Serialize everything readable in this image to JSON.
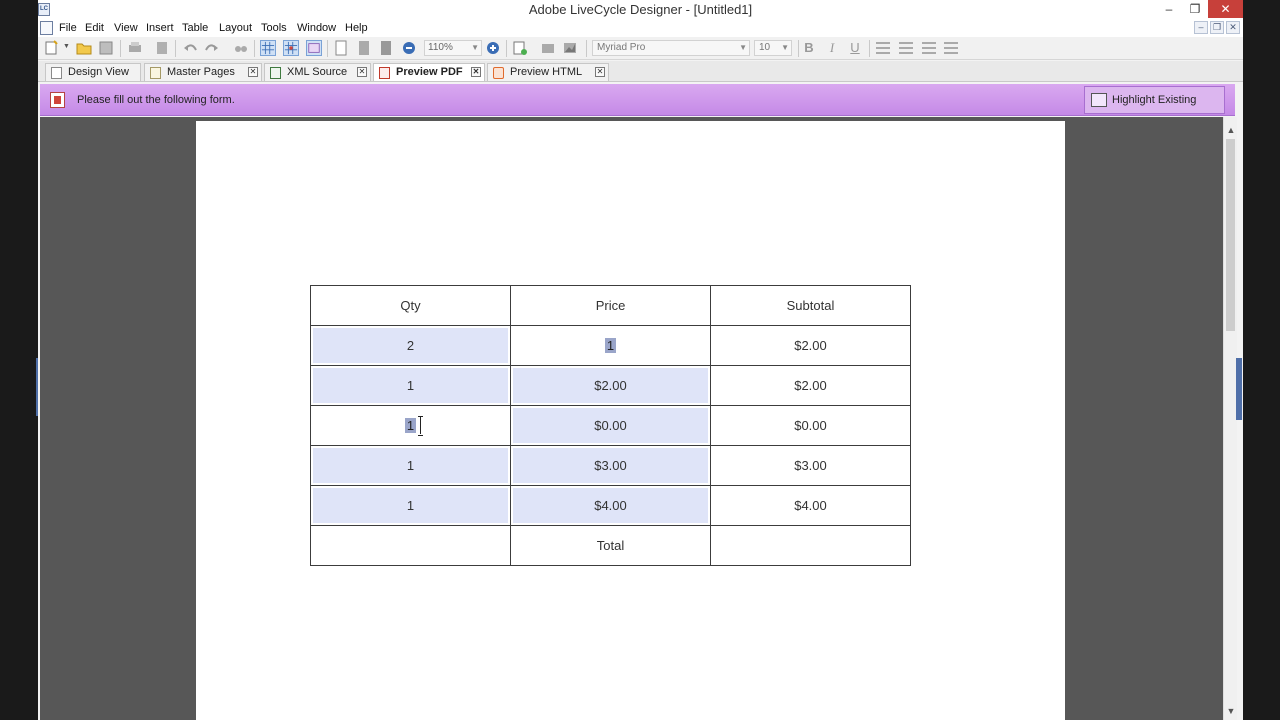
{
  "window": {
    "title": "Adobe LiveCycle Designer - [Untitled1]",
    "app_icon_label": "LC",
    "minimize": "–",
    "maximize": "❐",
    "close": "✕"
  },
  "menu": {
    "items": [
      "File",
      "Edit",
      "View",
      "Insert",
      "Table",
      "Layout",
      "Tools",
      "Window",
      "Help"
    ],
    "mdi": [
      "–",
      "❐",
      "✕"
    ]
  },
  "toolbar": {
    "zoom": "110%",
    "font": "Myriad Pro",
    "size": "10",
    "bold": "B",
    "italic": "I",
    "underline": "U"
  },
  "tabs": [
    {
      "label": "Design View",
      "icon": "document-icon",
      "active": false
    },
    {
      "label": "Master Pages",
      "icon": "master-pages-icon",
      "active": false
    },
    {
      "label": "XML Source",
      "icon": "xml-icon",
      "active": false
    },
    {
      "label": "Preview PDF",
      "icon": "pdf-icon",
      "active": true
    },
    {
      "label": "Preview HTML",
      "icon": "html5-icon",
      "active": false
    }
  ],
  "notice": {
    "text": "Please fill out the following form.",
    "button": "Highlight Existing Fields"
  },
  "form": {
    "headers": [
      "Qty",
      "Price",
      "Subtotal"
    ],
    "rows": [
      {
        "qty": "2",
        "price": "1",
        "subtotal": "$2.00"
      },
      {
        "qty": "1",
        "price": "$2.00",
        "subtotal": "$2.00"
      },
      {
        "qty": "1",
        "price": "$0.00",
        "subtotal": "$0.00"
      },
      {
        "qty": "1",
        "price": "$3.00",
        "subtotal": "$3.00"
      },
      {
        "qty": "1",
        "price": "$4.00",
        "subtotal": "$4.00"
      }
    ],
    "footer": {
      "label": "Total",
      "value": ""
    }
  },
  "colors": {
    "field_fill": "#dfe4f8",
    "notice_bar": "#c58ae7",
    "workspace": "#575757"
  }
}
